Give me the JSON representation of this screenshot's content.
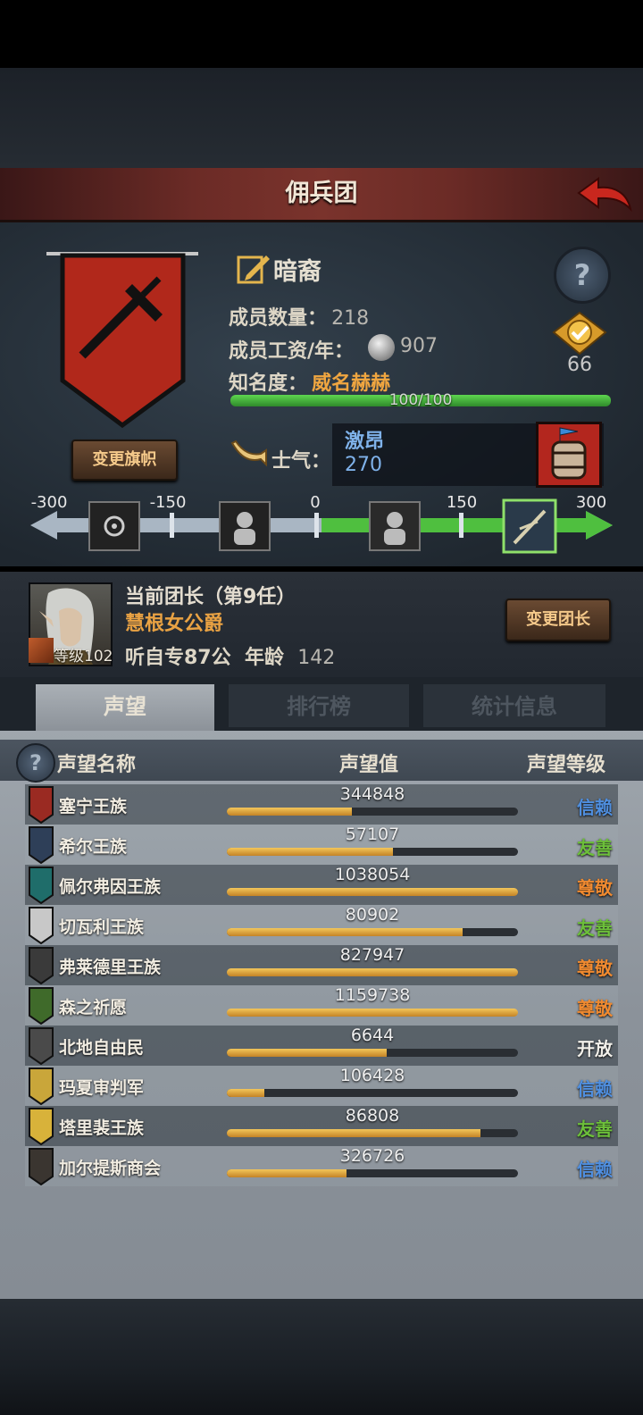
{
  "header": {
    "title": "佣兵团"
  },
  "guild": {
    "name": "暗裔",
    "members_label": "成员数量：",
    "members": "218",
    "wage_label": "成员工资/年：",
    "wage": "907",
    "fame_label": "知名度：",
    "fame_value": "威名赫赫",
    "fame_bar_text": "100/100",
    "fame_progress": 1.0,
    "medal_value": "66",
    "change_flag_label": "变更旗帜",
    "morale_label": "士气：",
    "morale_state": "激昂",
    "morale_value": "270"
  },
  "morale_scale": {
    "ticks": [
      "-300",
      "-150",
      "0",
      "150",
      "300"
    ],
    "current": 270,
    "range": [
      -300,
      300
    ]
  },
  "leader": {
    "title": "当前团长（第9任）",
    "name": "慧根女公爵",
    "level": "等级102",
    "info": "听自专87公",
    "age_label": "年龄",
    "age": "142",
    "change_label": "变更团长"
  },
  "tabs": {
    "reputation": "声望",
    "ranking": "排行榜",
    "stats": "统计信息"
  },
  "reputation": {
    "headers": {
      "name": "声望名称",
      "value": "声望值",
      "level": "声望等级"
    },
    "colors": {
      "trust": "#4f8fe0",
      "friendly": "#6cbf3a",
      "respect": "#f08a30",
      "open": "#f2f0ea"
    },
    "rows": [
      {
        "name": "塞宁王族",
        "value": "344848",
        "progress": 0.43,
        "level": "信赖",
        "color": "#4f8fe0",
        "crest": "#9a2a22"
      },
      {
        "name": "希尔王族",
        "value": "57107",
        "progress": 0.57,
        "level": "友善",
        "color": "#6cbf3a",
        "crest": "#2e3f58"
      },
      {
        "name": "佩尔弗因王族",
        "value": "1038054",
        "progress": 1.0,
        "level": "尊敬",
        "color": "#f08a30",
        "crest": "#1f6d6a"
      },
      {
        "name": "切瓦利王族",
        "value": "80902",
        "progress": 0.81,
        "level": "友善",
        "color": "#6cbf3a",
        "crest": "#c8c8c8"
      },
      {
        "name": "弗莱德里王族",
        "value": "827947",
        "progress": 1.0,
        "level": "尊敬",
        "color": "#f08a30",
        "crest": "#3a3a3a"
      },
      {
        "name": "森之祈愿",
        "value": "1159738",
        "progress": 1.0,
        "level": "尊敬",
        "color": "#f08a30",
        "crest": "#3f6a2a"
      },
      {
        "name": "北地自由民",
        "value": "6644",
        "progress": 0.55,
        "level": "开放",
        "color": "#f2f0ea",
        "crest": "#4a4a4a"
      },
      {
        "name": "玛夏审判军",
        "value": "106428",
        "progress": 0.13,
        "level": "信赖",
        "color": "#4f8fe0",
        "crest": "#c9a63a"
      },
      {
        "name": "塔里裴王族",
        "value": "86808",
        "progress": 0.87,
        "level": "友善",
        "color": "#6cbf3a",
        "crest": "#d8b23a"
      },
      {
        "name": "加尔提斯商会",
        "value": "326726",
        "progress": 0.41,
        "level": "信赖",
        "color": "#4f8fe0",
        "crest": "#3a3530"
      }
    ]
  }
}
